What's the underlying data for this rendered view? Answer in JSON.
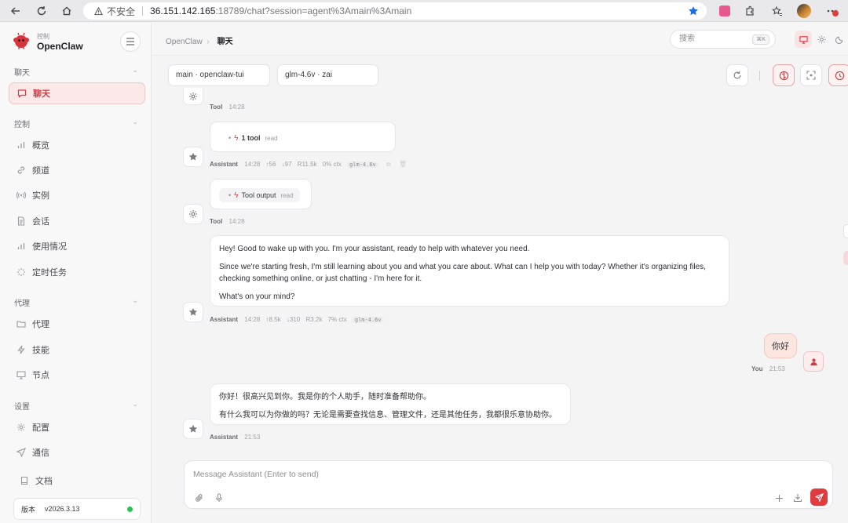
{
  "browser": {
    "security_label": "不安全",
    "url_host": "36.151.142.165",
    "url_rest": ":18789/chat?session=agent%3Amain%3Amain"
  },
  "sidebar": {
    "brand_sub": "控制",
    "brand_name": "OpenClaw",
    "groups": {
      "chat": "聊天",
      "control": "控制",
      "agent": "代理",
      "settings": "设置"
    },
    "items": {
      "chat": "聊天",
      "overview": "概览",
      "channels": "频道",
      "instances": "实例",
      "sessions": "会话",
      "usage": "使用情况",
      "cron": "定时任务",
      "agents": "代理",
      "skills": "技能",
      "nodes": "节点",
      "config": "配置",
      "comms": "通信",
      "docs": "文档"
    },
    "version_label": "版本",
    "version_value": "v2026.3.13"
  },
  "topbar": {
    "crumb_parent": "OpenClaw",
    "crumb_current": "聊天",
    "search_placeholder": "搜索",
    "search_kbd": "⌘K"
  },
  "session": {
    "agent_select": "main · openclaw-tui",
    "model_select": "glm-4.6v · zai"
  },
  "chat": {
    "tool1": {
      "who": "Tool",
      "time": "14:28"
    },
    "a1": {
      "pill_count": "1 tool",
      "pill_kind": "read",
      "who": "Assistant",
      "time": "14:28",
      "in": "↑56",
      "out": "↓97",
      "cache": "R11.5k",
      "ctx": "0% ctx",
      "model": "glm-4.6v"
    },
    "tool2": {
      "pill_name": "Tool output",
      "pill_kind": "read",
      "who": "Tool",
      "time": "14:28"
    },
    "a2": {
      "p1": "Hey! Good to wake up with you. I'm your assistant, ready to help with whatever you need.",
      "p2": "Since we're starting fresh, I'm still learning about you and what you care about. What can I help you with today? Whether it's organizing files, checking something online, or just chatting - I'm here for it.",
      "p3": "What's on your mind?",
      "who": "Assistant",
      "time": "14:28",
      "in": "↑8.5k",
      "out": "↓310",
      "cache": "R3.2k",
      "ctx": "7% ctx",
      "model": "glm-4.6v"
    },
    "user": {
      "text": "你好",
      "who": "You",
      "time": "21:53"
    },
    "a3": {
      "p1": "你好！很高兴见到你。我是你的个人助手，随时准备帮助你。",
      "p2": "有什么我可以为你做的吗？无论是需要查找信息、管理文件，还是其他任务，我都很乐意协助你。",
      "who": "Assistant",
      "time": "21:53"
    }
  },
  "composer": {
    "placeholder": "Message Assistant (Enter to send)"
  },
  "colors": {
    "accent": "#d03d44",
    "send": "#e03c3f",
    "online": "#2fbd55"
  }
}
